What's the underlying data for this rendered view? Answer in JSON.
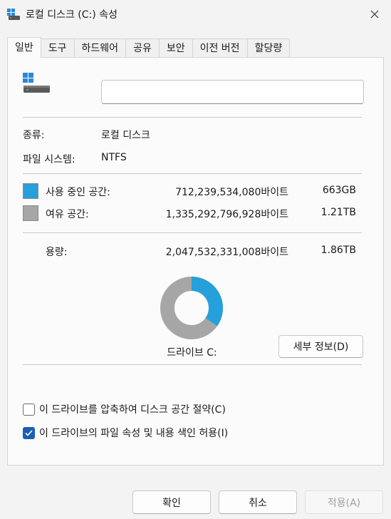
{
  "window": {
    "title": "로컬 디스크 (C:) 속성",
    "icons": {
      "title": "drive-icon",
      "close": "close-icon"
    }
  },
  "tabs": [
    {
      "label": "일반",
      "active": true
    },
    {
      "label": "도구"
    },
    {
      "label": "하드웨어"
    },
    {
      "label": "공유"
    },
    {
      "label": "보안"
    },
    {
      "label": "이전 버전"
    },
    {
      "label": "할당량"
    }
  ],
  "general": {
    "name_value": "",
    "type_label": "종류:",
    "type_value": "로컬 디스크",
    "fs_label": "파일 시스템:",
    "fs_value": "NTFS",
    "used_label": "사용 중인 공간:",
    "used_bytes": "712,239,534,080바이트",
    "used_size": "663GB",
    "free_label": "여유 공간:",
    "free_bytes": "1,335,292,796,928바이트",
    "free_size": "1.21TB",
    "capacity_label": "용량:",
    "capacity_bytes": "2,047,532,331,008바이트",
    "capacity_size": "1.86TB",
    "used_fraction": 0.348,
    "used_color": "#26a0da",
    "free_color": "#a6a6a6",
    "drive_label": "드라이브 C:",
    "details_button": "세부 정보(D)",
    "compress_label": "이 드라이브를 압축하여 디스크 공간 절약(C)",
    "compress_checked": false,
    "index_label": "이 드라이브의 파일 속성 및 내용 색인 허용(I)",
    "index_checked": true
  },
  "footer": {
    "ok": "확인",
    "cancel": "취소",
    "apply": "적용(A)"
  }
}
